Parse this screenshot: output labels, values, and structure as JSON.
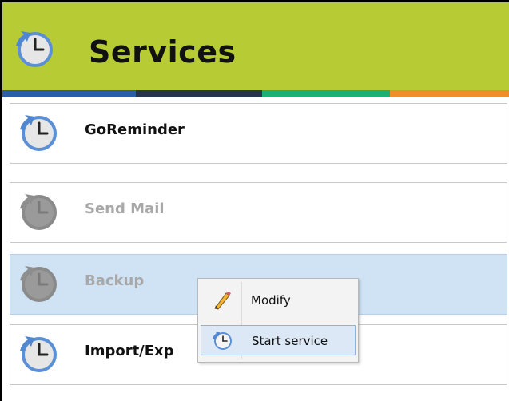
{
  "header": {
    "title": "Services",
    "icon": "clock-icon"
  },
  "stripe_colors": [
    "#2b5ea7",
    "#27354a",
    "#19b07a",
    "#ea8f2a"
  ],
  "services": [
    {
      "label": "GoReminder",
      "state": "enabled",
      "selected": false
    },
    {
      "label": "Send Mail",
      "state": "disabled",
      "selected": false
    },
    {
      "label": "Backup",
      "state": "disabled",
      "selected": true
    },
    {
      "label": "Import/Exp",
      "state": "enabled",
      "selected": false
    }
  ],
  "context_menu": {
    "items": [
      {
        "label": "Modify",
        "icon": "pencil-icon"
      },
      {
        "label": "Start service",
        "icon": "clock-icon",
        "hovered": true
      }
    ]
  },
  "colors": {
    "header_bg": "#b7cc34",
    "selected_bg": "#cfe3f5"
  }
}
